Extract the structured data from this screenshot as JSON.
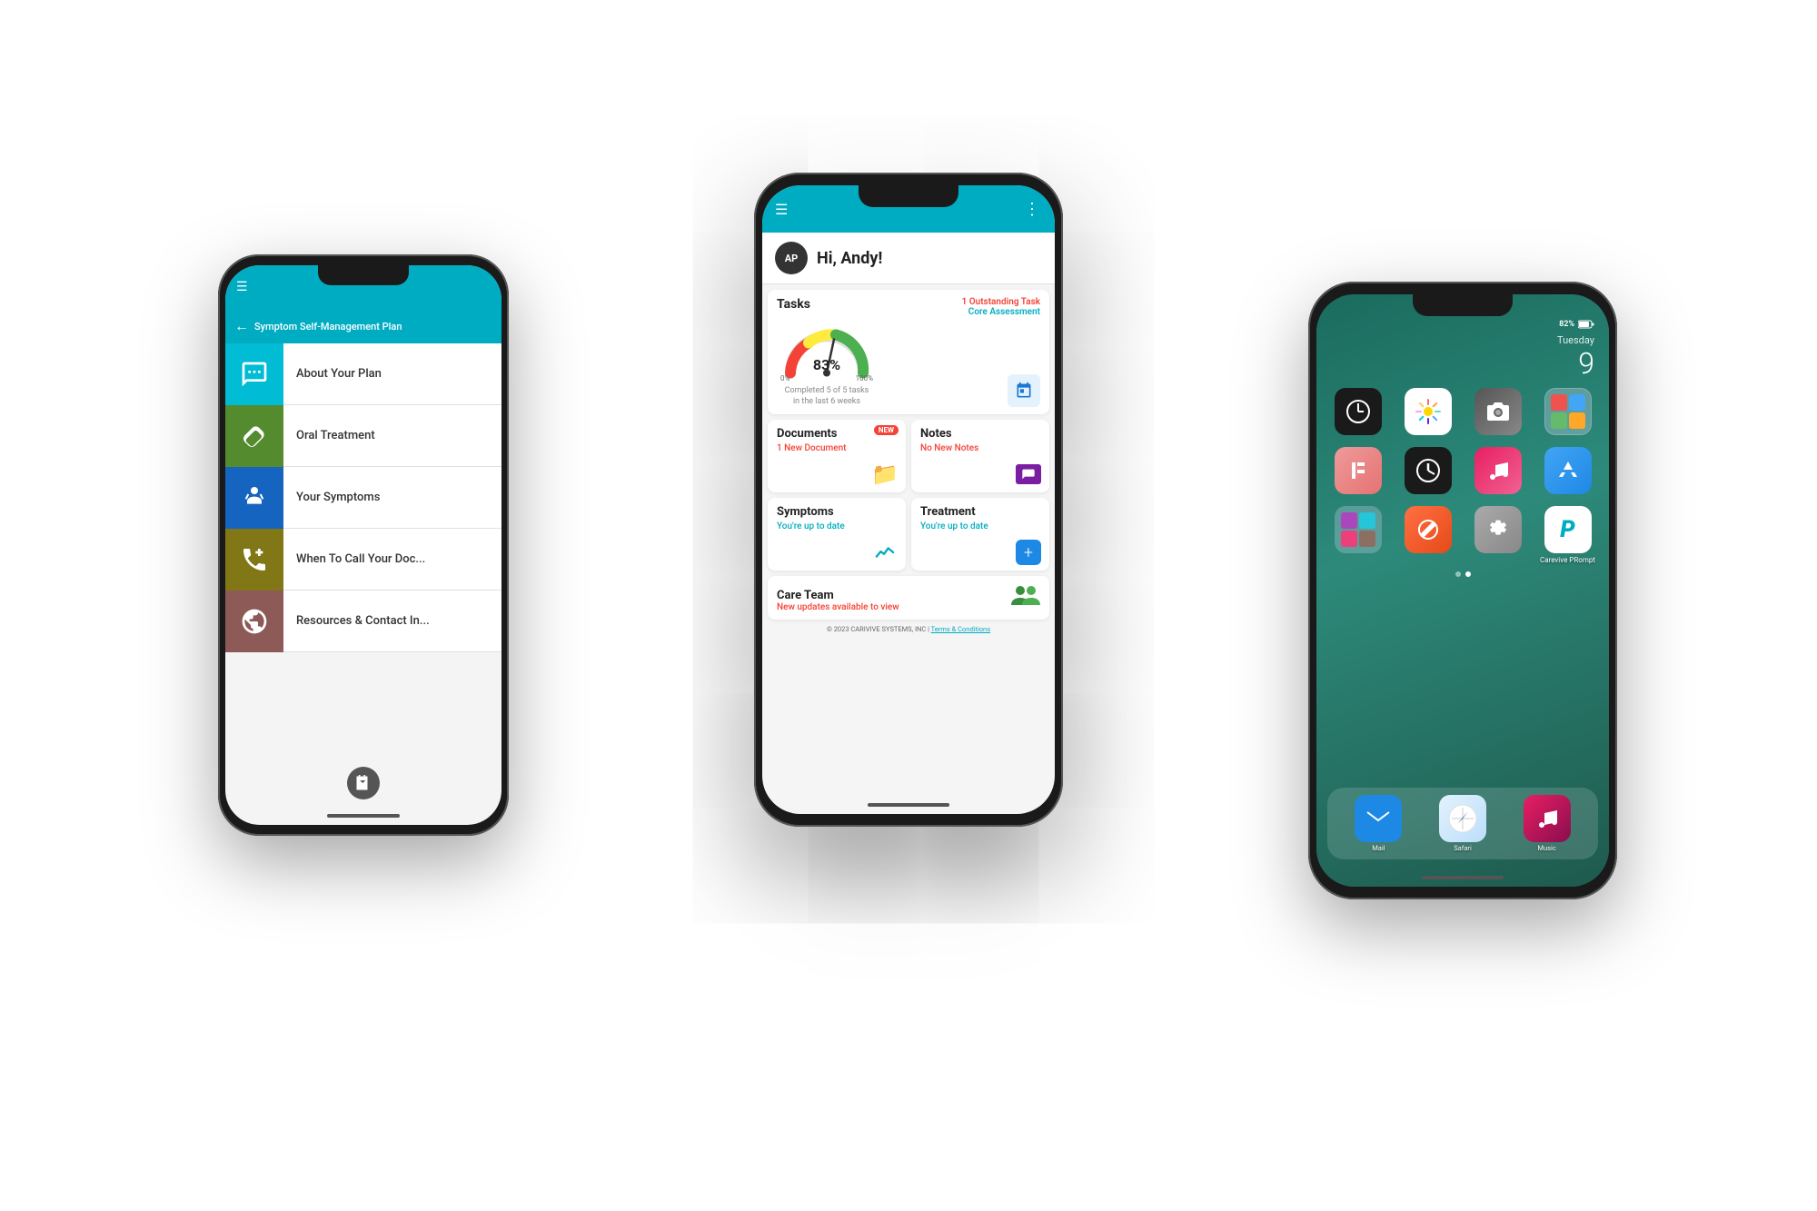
{
  "scene": {
    "bg": "#ffffff"
  },
  "leftPhone": {
    "header": {
      "hamburger": "☰"
    },
    "backNav": {
      "arrow": "←",
      "title": "Symptom Self-Management Plan"
    },
    "menuItems": [
      {
        "label": "About Your Plan",
        "iconColor": "teal",
        "iconType": "chat"
      },
      {
        "label": "Oral Treatment",
        "iconColor": "green",
        "iconType": "pill"
      },
      {
        "label": "Your Symptoms",
        "iconColor": "blue",
        "iconType": "person"
      },
      {
        "label": "When To Call Your Doc...",
        "iconColor": "olive",
        "iconType": "phone"
      },
      {
        "label": "Resources & Contact In...",
        "iconColor": "brown",
        "iconType": "globe"
      }
    ],
    "bottomIcon": "book"
  },
  "centerPhone": {
    "header": {
      "hamburger": "☰",
      "dots": "⋮"
    },
    "greeting": {
      "avatarText": "AP",
      "text": "Hi, Andy!"
    },
    "tasks": {
      "title": "Tasks",
      "outstanding": "1 Outstanding Task",
      "coreAssessment": "Core Assessment",
      "gaugePercent": "83%",
      "gaugeLabel0": "0%",
      "gaugeLabel100": "100%",
      "completed": "Completed 5 of 5 tasks",
      "inLastWeeks": "in the last 6 weeks"
    },
    "documents": {
      "title": "Documents",
      "badge": "NEW",
      "sub": "1 New Document"
    },
    "notes": {
      "title": "Notes",
      "sub": "No New Notes"
    },
    "symptoms": {
      "title": "Symptoms",
      "sub": "You're up to date"
    },
    "treatment": {
      "title": "Treatment",
      "sub": "You're up to date"
    },
    "careTeam": {
      "title": "Care Team",
      "sub": "New updates available to view"
    },
    "footer": {
      "text": "© 2023 CARIVIVE SYSTEMS, INC |",
      "linkText": "Terms & Conditions"
    }
  },
  "rightPhone": {
    "statusBar": {
      "day": "Tuesday",
      "date": "9",
      "battery": "82%"
    },
    "apps": [
      {
        "label": "",
        "type": "clock"
      },
      {
        "label": "",
        "type": "photos"
      },
      {
        "label": "",
        "type": "camera"
      },
      {
        "label": "",
        "type": "folder1"
      },
      {
        "label": "",
        "type": "folder2"
      },
      {
        "label": "",
        "type": "clock2"
      },
      {
        "label": "",
        "type": "music"
      },
      {
        "label": "",
        "type": "store"
      },
      {
        "label": "",
        "type": "folder3"
      },
      {
        "label": "",
        "type": "folder4"
      },
      {
        "label": "",
        "type": "settings"
      },
      {
        "label": "Carevive PRompt",
        "type": "carevive"
      }
    ],
    "dock": [
      {
        "label": "Mail",
        "type": "mail"
      },
      {
        "label": "Safari",
        "type": "safari"
      },
      {
        "label": "Music",
        "type": "music-dock"
      }
    ]
  }
}
